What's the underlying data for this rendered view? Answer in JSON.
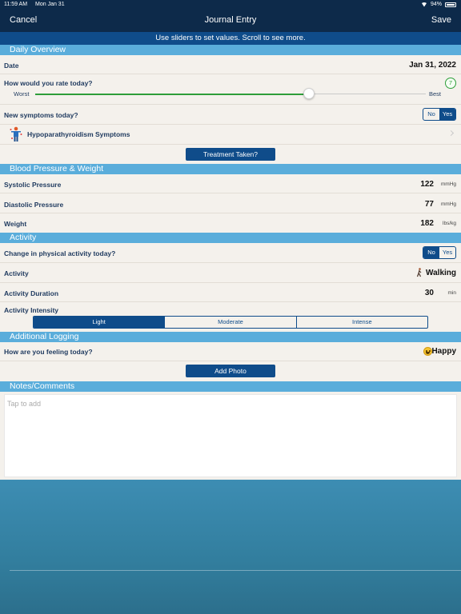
{
  "status_bar": {
    "time": "11:59 AM",
    "date": "Mon Jan 31",
    "battery": "94%"
  },
  "nav": {
    "cancel": "Cancel",
    "title": "Journal Entry",
    "save": "Save"
  },
  "hint": "Use sliders to set values. Scroll to see more.",
  "sections": {
    "daily": "Daily Overview",
    "bp": "Blood Pressure & Weight",
    "activity": "Activity",
    "additional": "Additional Logging",
    "notes": "Notes/Comments"
  },
  "daily": {
    "date_label": "Date",
    "date_value": "Jan 31, 2022",
    "rating_label": "How would you rate today?",
    "rating_value": "7",
    "rating_fraction": 0.7,
    "slider_min_label": "Worst",
    "slider_max_label": "Best",
    "symptoms_label": "New symptoms today?",
    "symptoms_toggle": {
      "no": "No",
      "yes": "Yes",
      "selected": "yes"
    },
    "symptoms_link": "Hypoparathyroidism Symptoms",
    "treatment_button": "Treatment Taken?"
  },
  "bp": {
    "systolic_label": "Systolic Pressure",
    "systolic_value": "122",
    "systolic_unit": "mmHg",
    "diastolic_label": "Diastolic Pressure",
    "diastolic_value": "77",
    "diastolic_unit": "mmHg",
    "weight_label": "Weight",
    "weight_value": "182",
    "weight_unit": "lbs/kg"
  },
  "activity": {
    "change_label": "Change in physical activity today?",
    "change_toggle": {
      "no": "No",
      "yes": "Yes",
      "selected": "no"
    },
    "activity_label": "Activity",
    "activity_value": "Walking",
    "duration_label": "Activity Duration",
    "duration_value": "30",
    "duration_unit": "min",
    "intensity_label": "Activity Intensity",
    "intensity_options": [
      "Light",
      "Moderate",
      "Intense"
    ],
    "intensity_selected": "Light"
  },
  "additional": {
    "feeling_label": "How are you feeling today?",
    "feeling_value": "Happy",
    "add_photo": "Add Photo"
  },
  "notes": {
    "placeholder": "Tap to add"
  },
  "colors": {
    "nav": "#0d2a4a",
    "primary": "#0f4c8a",
    "section": "#5aaddb",
    "slider": "#2e9e3a"
  }
}
